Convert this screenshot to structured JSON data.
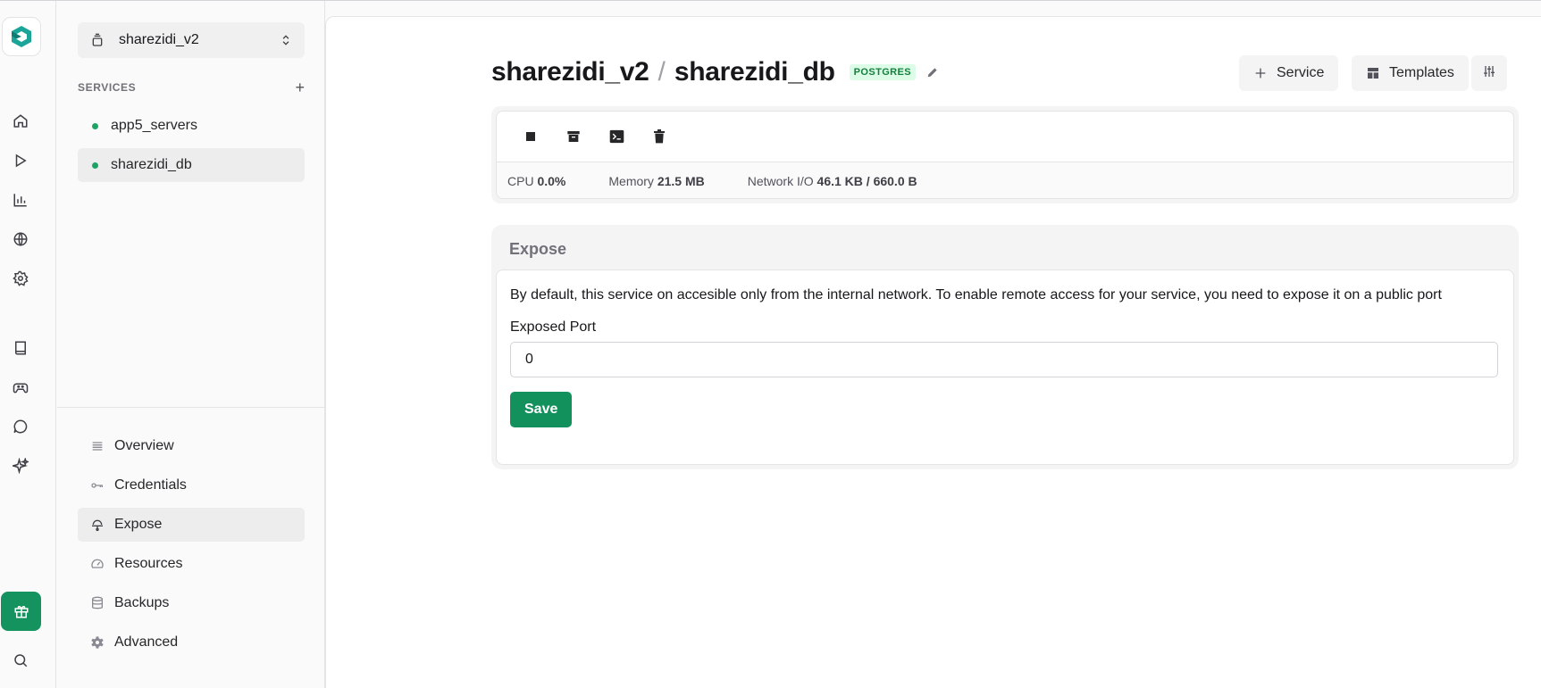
{
  "rail": {
    "items": [
      {
        "name": "home-icon"
      },
      {
        "name": "play-icon"
      },
      {
        "name": "chart-icon"
      },
      {
        "name": "globe-icon"
      },
      {
        "name": "settings-icon"
      },
      {
        "name": "book-icon"
      },
      {
        "name": "gamepad-icon"
      },
      {
        "name": "chat-icon"
      },
      {
        "name": "sparkles-icon"
      }
    ],
    "gift_icon": "gift-icon",
    "search_icon": "search-icon"
  },
  "sidebar": {
    "project": "sharezidi_v2",
    "services_heading": "SERVICES",
    "services": [
      {
        "label": "app5_servers",
        "status": "running"
      },
      {
        "label": "sharezidi_db",
        "status": "running",
        "active": true
      }
    ],
    "nav": [
      {
        "label": "Overview",
        "icon": "list-icon"
      },
      {
        "label": "Credentials",
        "icon": "key-icon"
      },
      {
        "label": "Expose",
        "icon": "expose-icon",
        "active": true
      },
      {
        "label": "Resources",
        "icon": "gauge-icon"
      },
      {
        "label": "Backups",
        "icon": "database-icon"
      },
      {
        "label": "Advanced",
        "icon": "cog-icon"
      }
    ]
  },
  "header": {
    "project": "sharezidi_v2",
    "separator": "/",
    "service": "sharezidi_db",
    "badge": "POSTGRES",
    "service_button": "Service",
    "templates_button": "Templates"
  },
  "controls": {
    "stats": {
      "cpu_label": "CPU",
      "cpu_value": "0.0%",
      "memory_label": "Memory",
      "memory_value": "21.5 MB",
      "network_label": "Network I/O",
      "network_value": "46.1 KB / 660.0 B"
    }
  },
  "expose": {
    "heading": "Expose",
    "description": "By default, this service on accesible only from the internal network. To enable remote access for your service, you need to expose it on a public port",
    "port_label": "Exposed Port",
    "port_value": "0",
    "save_label": "Save"
  },
  "colors": {
    "accent": "#12915d",
    "badge_bg": "#dcfce7",
    "badge_text": "#15803d",
    "status_dot": "#1fa364"
  }
}
